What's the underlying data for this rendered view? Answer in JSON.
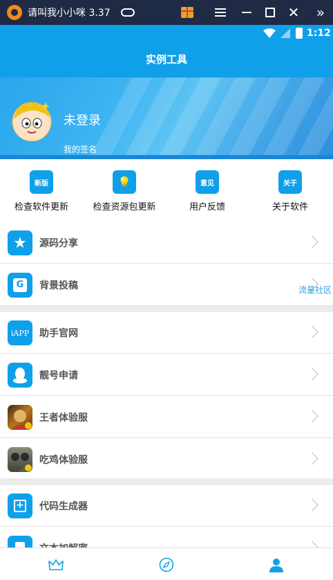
{
  "emulator": {
    "title": "请叫我小小咪 3.37",
    "close_symbol": "✕",
    "expand_symbol": "»"
  },
  "status_bar": {
    "time": "1:12"
  },
  "header": {
    "title": "实例工具"
  },
  "profile": {
    "username": "未登录",
    "signature": "我的签名"
  },
  "quick_actions": [
    {
      "icon_text": "新版",
      "label": "检查软件更新"
    },
    {
      "icon_text": "💡",
      "label": "检查资源包更新"
    },
    {
      "icon_text": "意见",
      "label": "用户反馈"
    },
    {
      "icon_text": "关于",
      "label": "关于软件"
    }
  ],
  "menu_items": [
    {
      "icon": "star-icon",
      "icon_text": "★",
      "label": "源码分享"
    },
    {
      "icon": "translate-icon",
      "icon_text": "G",
      "label": "背景投稿"
    },
    {
      "icon": "iapp-icon",
      "icon_text": "iAPP",
      "label": "助手官网"
    },
    {
      "icon": "qq-icon",
      "icon_text": "",
      "label": "靓号申请"
    },
    {
      "icon": "hero-game-icon",
      "icon_text": "",
      "label": "王者体验服"
    },
    {
      "icon": "pubg-game-icon",
      "icon_text": "",
      "label": "吃鸡体验服"
    },
    {
      "icon": "code-generator-icon",
      "icon_text": "+",
      "label": "代码生成器"
    },
    {
      "icon": "text-encrypt-icon",
      "icon_text": "",
      "label": "文本加解密"
    }
  ],
  "watermark": "流量社区",
  "bottom_nav": [
    {
      "icon": "crown-icon"
    },
    {
      "icon": "compass-icon"
    },
    {
      "icon": "person-icon"
    }
  ],
  "colors": {
    "accent": "#10a0ea",
    "emulator_bar": "#1f2a44",
    "divider": "#ececec"
  }
}
